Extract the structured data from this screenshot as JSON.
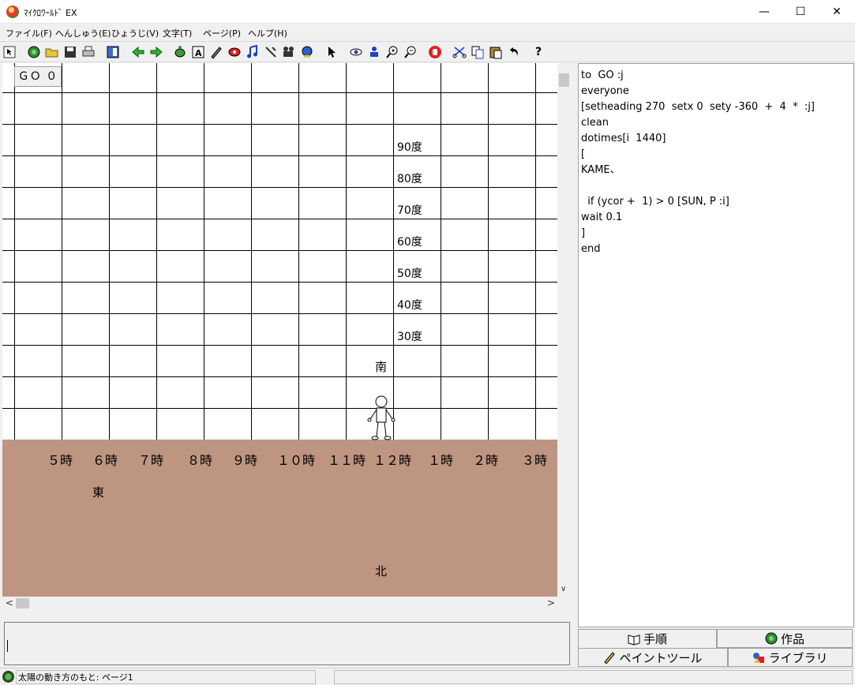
{
  "window": {
    "title": "ﾏｲｸﾛﾜｰﾙﾄﾞ EX",
    "minimize": "—",
    "maximize": "☐",
    "close": "✕"
  },
  "menu": [
    {
      "label": "ファイル(F)"
    },
    {
      "label": "へんしゅう(E)"
    },
    {
      "label": "ひょうじ(V)"
    },
    {
      "label": "文字(T)"
    },
    {
      "label": "ページ(P)"
    },
    {
      "label": "ヘルプ(H)"
    }
  ],
  "toolbar": {
    "help_label": "?"
  },
  "stage": {
    "go_button": "ＧＯ ０",
    "degrees": [
      "90度",
      "80度",
      "70度",
      "60度",
      "50度",
      "40度",
      "30度"
    ],
    "hours": [
      "５時",
      "６時",
      "７時",
      "８時",
      "９時",
      "１０時",
      "１１時",
      "１２時",
      "１時",
      "２時",
      "３時"
    ],
    "directions": {
      "south": "南",
      "east": "東",
      "north": "北"
    }
  },
  "editor": {
    "lines": [
      "to  GO :j",
      "everyone",
      "[setheading 270  setx 0  sety -360  +  4  *  :j]",
      "clean",
      "dotimes[i  1440]",
      "[",
      "KAME、",
      "",
      "  if (ycor +  1) > 0 [SUN, P :i]",
      "wait 0.1",
      "]",
      "end"
    ]
  },
  "tabs": {
    "procedure": "手順",
    "works": "作品",
    "paint": "ペイントツール",
    "library": "ライブラリ"
  },
  "status": {
    "text": "太陽の動き方のもと: ページ1"
  }
}
